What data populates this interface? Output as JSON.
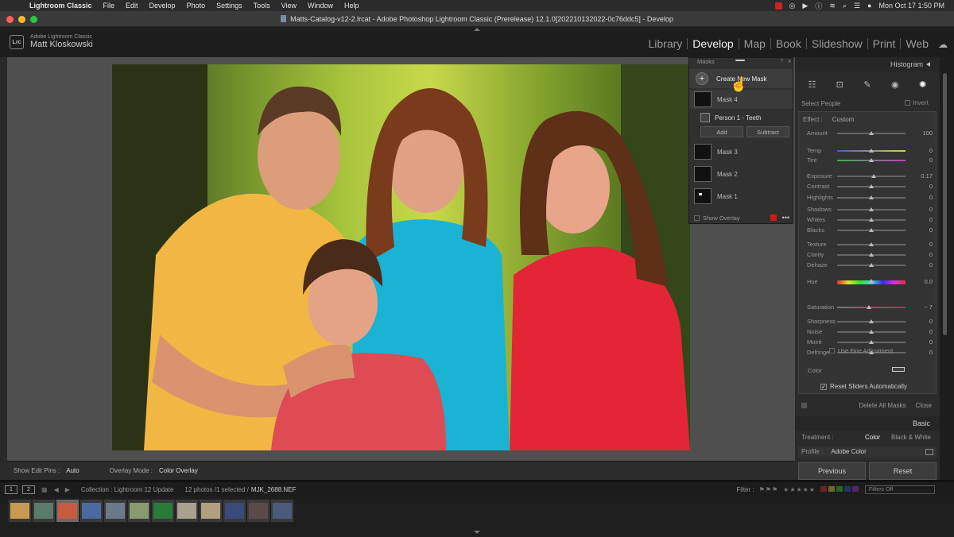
{
  "menubar": {
    "app": "Lightroom Classic",
    "items": [
      "File",
      "Edit",
      "Develop",
      "Photo",
      "Settings",
      "Tools",
      "View",
      "Window",
      "Help"
    ],
    "clock": "Mon Oct 17  1:50 PM"
  },
  "window": {
    "title": "Matts-Catalog-v12-2.lrcat - Adobe Photoshop Lightroom Classic (Prerelease) 12.1.0[202210132022-0c76ddc5] - Develop"
  },
  "identity": {
    "badge": "Lrc",
    "product": "Adobe Lightroom Classic",
    "user": "Matt Kloskowski"
  },
  "modules": [
    "Library",
    "Develop",
    "Map",
    "Book",
    "Slideshow",
    "Print",
    "Web"
  ],
  "active_module": "Develop",
  "masks": {
    "header": "Masks",
    "help": "?",
    "collapse": "»",
    "create": "Create New Mask",
    "items": [
      {
        "label": "Mask 4"
      },
      {
        "label": "Mask 3"
      },
      {
        "label": "Mask 2"
      },
      {
        "label": "Mask 1"
      }
    ],
    "component": "Person 1 - Teeth",
    "add": "Add",
    "subtract": "Subtract",
    "show_overlay": "Show Overlay",
    "more": "•••",
    "overlay_color": "#d01818"
  },
  "panel": {
    "histogram": "Histogram",
    "select": "Select People",
    "invert": "Invert",
    "effect_label": "Effect :",
    "effect_value": "Custom",
    "sliders": [
      {
        "name": "Amount",
        "value": "100",
        "pos": 0.5
      },
      {
        "name": "Temp",
        "value": "0",
        "pos": 0.5
      },
      {
        "name": "Tint",
        "value": "0",
        "pos": 0.5
      },
      {
        "name": "Exposure",
        "value": "0.17",
        "pos": 0.53
      },
      {
        "name": "Contrast",
        "value": "0",
        "pos": 0.5
      },
      {
        "name": "Highlights",
        "value": "0",
        "pos": 0.5
      },
      {
        "name": "Shadows",
        "value": "0",
        "pos": 0.5
      },
      {
        "name": "Whites",
        "value": "0",
        "pos": 0.5
      },
      {
        "name": "Blacks",
        "value": "0",
        "pos": 0.5
      },
      {
        "name": "Texture",
        "value": "0",
        "pos": 0.5
      },
      {
        "name": "Clarity",
        "value": "0",
        "pos": 0.5
      },
      {
        "name": "Dehaze",
        "value": "0",
        "pos": 0.5
      },
      {
        "name": "Hue",
        "value": "0.0",
        "pos": 0.5
      },
      {
        "name": "Saturation",
        "value": "− 7",
        "pos": 0.46
      },
      {
        "name": "Sharpness",
        "value": "0",
        "pos": 0.5
      },
      {
        "name": "Noise",
        "value": "0",
        "pos": 0.5
      },
      {
        "name": "Moiré",
        "value": "0",
        "pos": 0.5
      },
      {
        "name": "Defringe",
        "value": "0",
        "pos": 0.5
      }
    ],
    "fine_adjustment": "Use Fine Adjustment",
    "color": "Color",
    "reset_sliders": "Reset Sliders Automatically",
    "delete_all": "Delete All Masks",
    "close": "Close",
    "basic": "Basic",
    "treatment_label": "Treatment :",
    "treatment_color": "Color",
    "treatment_bw": "Black & White",
    "profile_label": "Profile :",
    "profile_value": "Adobe Color",
    "previous": "Previous",
    "reset": "Reset"
  },
  "toolbar": {
    "edit_pins_label": "Show Edit Pins :",
    "edit_pins_value": "Auto",
    "overlay_mode_label": "Overlay Mode :",
    "overlay_mode_value": "Color Overlay"
  },
  "filmstrip": {
    "view1": "1",
    "view2": "2",
    "collection": "Collection : Lightroom 12 Update",
    "count": "12 photos /1 selected /",
    "filename": "MJK_2688.NEF",
    "filter_label": "Filter :",
    "filters_off": "Filters Off",
    "thumbs": 12,
    "selected_index": 2
  }
}
